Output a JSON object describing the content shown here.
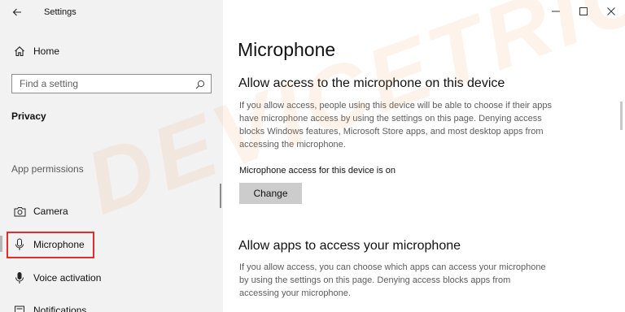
{
  "window": {
    "title": "Settings",
    "back_icon": "arrow-left-icon",
    "controls": {
      "minimize": "—",
      "maximize": "☐",
      "close": "✕"
    }
  },
  "sidebar": {
    "home_label": "Home",
    "search": {
      "placeholder": "Find a setting"
    },
    "section_title": "Privacy",
    "group_label": "App permissions",
    "items": [
      {
        "label": "Camera",
        "icon": "camera-icon"
      },
      {
        "label": "Microphone",
        "icon": "microphone-icon",
        "selected": true
      },
      {
        "label": "Voice activation",
        "icon": "voice-activation-icon"
      },
      {
        "label": "Notifications",
        "icon": "notifications-icon"
      }
    ]
  },
  "main": {
    "page_title": "Microphone",
    "section1": {
      "heading": "Allow access to the microphone on this device",
      "description": "If you allow access, people using this device will be able to choose if their apps have microphone access by using the settings on this page. Denying access blocks Windows features, Microsoft Store apps, and most desktop apps from accessing the microphone.",
      "status": "Microphone access for this device is on",
      "button_label": "Change"
    },
    "section2": {
      "heading": "Allow apps to access your microphone",
      "description": "If you allow access, you can choose which apps can access your microphone by using the settings on this page. Denying access blocks apps from accessing your microphone."
    }
  },
  "watermark": {
    "text": "DEVICETRICKS"
  },
  "colors": {
    "highlight": "#e32d2d",
    "sidebar_bg": "#f2f2f2",
    "button_bg": "#cccccc"
  }
}
